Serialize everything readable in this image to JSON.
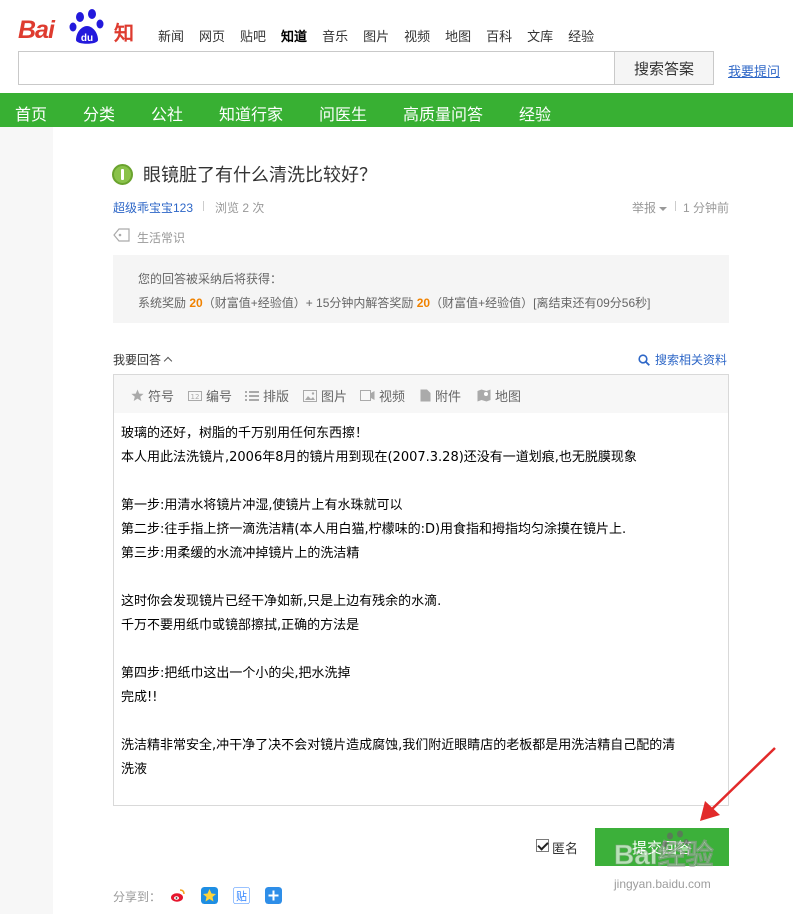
{
  "header": {
    "logo_text_bai": "Bai",
    "logo_text_du": "du",
    "logo_text_zhidao": "知道",
    "nav": [
      {
        "label": "新闻",
        "active": false
      },
      {
        "label": "网页",
        "active": false
      },
      {
        "label": "贴吧",
        "active": false
      },
      {
        "label": "知道",
        "active": true
      },
      {
        "label": "音乐",
        "active": false
      },
      {
        "label": "图片",
        "active": false
      },
      {
        "label": "视频",
        "active": false
      },
      {
        "label": "地图",
        "active": false
      },
      {
        "label": "百科",
        "active": false
      },
      {
        "label": "文库",
        "active": false
      },
      {
        "label": "经验",
        "active": false
      }
    ],
    "search_value": "",
    "search_button": "搜索答案",
    "ask_link": "我要提问"
  },
  "greenbar": {
    "items": [
      "首页",
      "分类",
      "公社",
      "知道行家",
      "问医生",
      "高质量问答",
      "经验"
    ]
  },
  "question": {
    "title": "眼镜脏了有什么清洗比较好？",
    "user": "超级乖宝宝123",
    "views": "浏览 2 次",
    "report": "举报",
    "time": "1 分钟前",
    "tag": "生活常识"
  },
  "reward": {
    "line1": "您的回答被采纳后将获得：",
    "part1": "系统奖励 ",
    "value1": "20",
    "part2": "（财富值+经验值）+ 15分钟内解答奖励 ",
    "value2": "20",
    "part3": "（财富值+经验值）[离结束还有09分56秒]"
  },
  "answer": {
    "label": "我要回答",
    "search_related": "搜索相关资料",
    "toolbar": [
      "符号",
      "编号",
      "排版",
      "图片",
      "视频",
      "附件",
      "地图"
    ],
    "lines": [
      "玻璃的还好，树脂的千万别用任何东西擦！",
      "本人用此法洗镜片,2006年8月的镜片用到现在(2007.3.28)还没有一道划痕,也无脱膜现象",
      "",
      "第一步:用清水将镜片冲湿,使镜片上有水珠就可以",
      "第二步:往手指上挤一滴洗洁精(本人用白猫,柠檬味的:D)用食指和拇指均匀涂摸在镜片上.",
      "第三步:用柔缓的水流冲掉镜片上的洗洁精",
      "",
      "这时你会发现镜片已经干净如新,只是上边有残余的水滴.",
      "千万不要用纸巾或镜部擦拭,正确的方法是",
      "",
      "第四步:把纸巾这出一个小的尖,把水洗掉",
      "完成!!",
      "",
      "洗洁精非常安全,冲干净了决不会对镜片造成腐蚀,我们附近眼睛店的老板都是用洗洁精自己配的清",
      "洗液"
    ],
    "anonymous_label": "匿名",
    "anonymous_checked": true,
    "submit": "提交回答"
  },
  "share": {
    "label": "分享到："
  },
  "watermark": {
    "text": "Bai经验",
    "url": "jingyan.baidu.com"
  },
  "colors": {
    "green": "#38b033",
    "link": "#2e67c7",
    "brand_red": "#de3b2f",
    "brand_blue": "#2319dc",
    "highlight": "#f08200"
  }
}
